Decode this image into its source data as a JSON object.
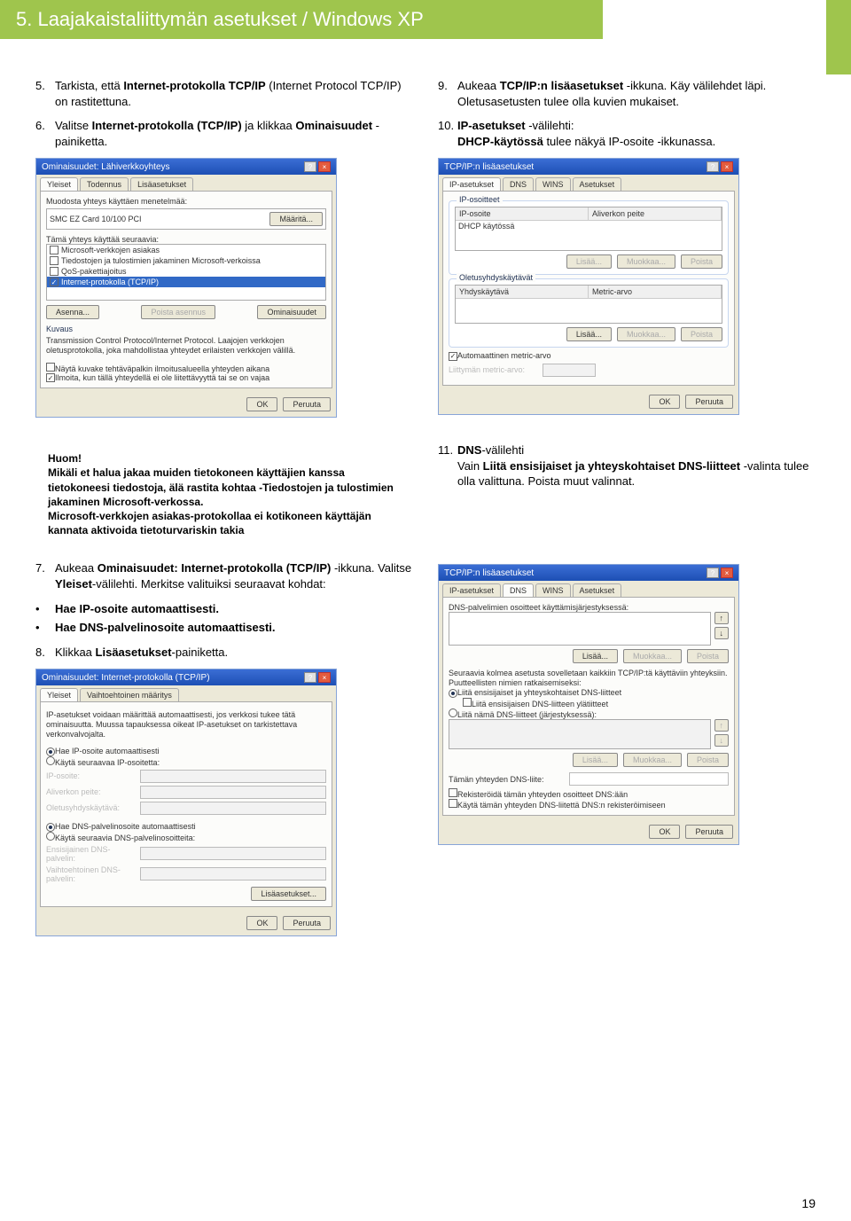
{
  "page_number": "19",
  "header": "5. Laajakaistaliittymän asetukset / Windows XP",
  "left": {
    "step5": {
      "num": "5.",
      "p1": "Tarkista, että ",
      "b1": "Internet-protokolla TCP/IP",
      "p2": " (Internet Protocol TCP/IP) on rastitettuna."
    },
    "step6": {
      "num": "6.",
      "p1": "Valitse ",
      "b1": "Internet-protokolla (TCP/IP)",
      "p2": " ja klikkaa ",
      "b2": "Ominaisuudet",
      "p3": " -painiketta."
    },
    "step7": {
      "num": "7.",
      "p1": "Aukeaa ",
      "b1": "Ominaisuudet: Internet-protokolla (TCP/IP)",
      "p2": " -ikkuna. Valitse ",
      "b2": "Yleiset",
      "p3": "-välilehti. Merkitse valituiksi seuraavat kohdat:"
    },
    "bul1": "Hae IP-osoite automaattisesti.",
    "bul2": "Hae DNS-palvelinosoite automaattisesti.",
    "step8": {
      "num": "8.",
      "p1": "Klikkaa ",
      "b1": "Lisäasetukset",
      "p2": "-painiketta."
    }
  },
  "right": {
    "step9": {
      "num": "9.",
      "p1": "Aukeaa ",
      "b1": "TCP/IP:n lisäasetukset",
      "p2": " -ikkuna. Käy välilehdet läpi. Oletusasetusten tulee olla kuvien mukaiset."
    },
    "step10": {
      "num": "10.",
      "b1": "IP-asetukset",
      "p1": " -välilehti:",
      "b2": "DHCP-käytössä",
      "p2": " tulee näkyä IP-osoite -ikkunassa."
    },
    "step11": {
      "num": "11.",
      "b1": "DNS",
      "p1": "-välilehti",
      "p2": "Vain ",
      "b2": "Liitä ensisijaiset ja yhteyskohtaiset DNS-liitteet",
      "p3": " -valinta tulee olla valittuna. Poista muut valinnat."
    }
  },
  "huom": {
    "title": "Huom!",
    "p1": "Mikäli et halua jakaa muiden tietokoneen käyttäjien kanssa tietokoneesi tiedostoja, älä rastita kohtaa -Tiedostojen ja tulostimien jakaminen Microsoft-verkossa.",
    "p2": "Microsoft-verkkojen asiakas-protokollaa ei kotikoneen käyttäjän kannata aktivoida tietoturvariskin takia"
  },
  "win1": {
    "title": "Ominaisuudet: Lähiverkkoyhteys",
    "tabs": [
      "Yleiset",
      "Todennus",
      "Lisäasetukset"
    ],
    "method_label": "Muodosta yhteys käyttäen menetelmää:",
    "adapter": "SMC EZ Card 10/100 PCI",
    "btn_maarita": "Määritä...",
    "uses_label": "Tämä yhteys käyttää seuraavia:",
    "items": [
      "Microsoft-verkkojen asiakas",
      "Tiedostojen ja tulostimien jakaminen Microsoft-verkoissa",
      "QoS-pakettiajoitus",
      "Internet-protokolla (TCP/IP)"
    ],
    "btn_asenna": "Asenna...",
    "btn_poista": "Poista asennus",
    "btn_omin": "Ominaisuudet",
    "kuvaus_lbl": "Kuvaus",
    "kuvaus_txt": "Transmission Control Protocol/Internet Protocol. Laajojen verkkojen oletusprotokolla, joka mahdollistaa yhteydet erilaisten verkkojen välillä.",
    "chk1": "Näytä kuvake tehtäväpalkin ilmoitusalueella yhteyden aikana",
    "chk2": "Ilmoita, kun tällä yhteydellä ei ole liitettävyyttä tai se on vajaa",
    "ok": "OK",
    "cancel": "Peruuta"
  },
  "win2": {
    "title": "TCP/IP:n lisäasetukset",
    "tabs": [
      "IP-asetukset",
      "DNS",
      "WINS",
      "Asetukset"
    ],
    "grp_ip": "IP-osoitteet",
    "hdr_ip": "IP-osoite",
    "hdr_mask": "Aliverkon peite",
    "dhcp": "DHCP käytössä",
    "grp_gw": "Oletusyhdyskäytävät",
    "hdr_gw": "Yhdyskäytävä",
    "hdr_metric": "Metric-arvo",
    "btn_lisaa": "Lisää...",
    "btn_muokkaa": "Muokkaa...",
    "btn_poista": "Poista",
    "chk_auto": "Automaattinen metric-arvo",
    "lbl_metric": "Liittymän metric-arvo:",
    "ok": "OK",
    "cancel": "Peruuta"
  },
  "win3": {
    "title": "TCP/IP:n lisäasetukset",
    "tabs": [
      "IP-asetukset",
      "DNS",
      "WINS",
      "Asetukset"
    ],
    "lbl1": "DNS-palvelimien osoitteet käyttämisjärjestyksessä:",
    "lbl2": "Seuraavia kolmea asetusta sovelletaan kaikkiin TCP/IP:tä käyttäviin yhteyksiin. Puutteellisten nimien ratkaisemiseksi:",
    "r1": "Liitä ensisijaiset ja yhteyskohtaiset DNS-liitteet",
    "c1": "Liitä ensisijaisen DNS-liitteen ylätiitteet",
    "r2": "Liitä nämä DNS-liitteet (järjestyksessä):",
    "lbl3": "Tämän yhteyden DNS-liite:",
    "c2": "Rekisteröidä tämän yhteyden osoitteet DNS:ään",
    "c3": "Käytä tämän yhteyden DNS-liitettä DNS:n rekisteröimiseen",
    "btn_lisaa": "Lisää...",
    "btn_muokkaa": "Muokkaa...",
    "btn_poista": "Poista",
    "up": "↑",
    "down": "↓",
    "ok": "OK",
    "cancel": "Peruuta"
  },
  "win4": {
    "title": "Ominaisuudet: Internet-protokolla (TCP/IP)",
    "tabs": [
      "Yleiset",
      "Vaihtoehtoinen määritys"
    ],
    "intro": "IP-asetukset voidaan määrittää automaattisesti, jos verkkosi tukee tätä ominaisuutta. Muussa tapauksessa oikeat IP-asetukset on tarkistettava verkonvalvojalta.",
    "r1": "Hae IP-osoite automaattisesti",
    "r2": "Käytä seuraavaa IP-osoitetta:",
    "f_ip": "IP-osoite:",
    "f_mask": "Aliverkon peite:",
    "f_gw": "Oletusyhdyskäytävä:",
    "r3": "Hae DNS-palvelinosoite automaattisesti",
    "r4": "Käytä seuraavia DNS-palvelinosoitteita:",
    "f_dns1": "Ensisijainen DNS-palvelin:",
    "f_dns2": "Vaihtoehtoinen DNS-palvelin:",
    "btn_adv": "Lisäasetukset...",
    "ok": "OK",
    "cancel": "Peruuta"
  }
}
